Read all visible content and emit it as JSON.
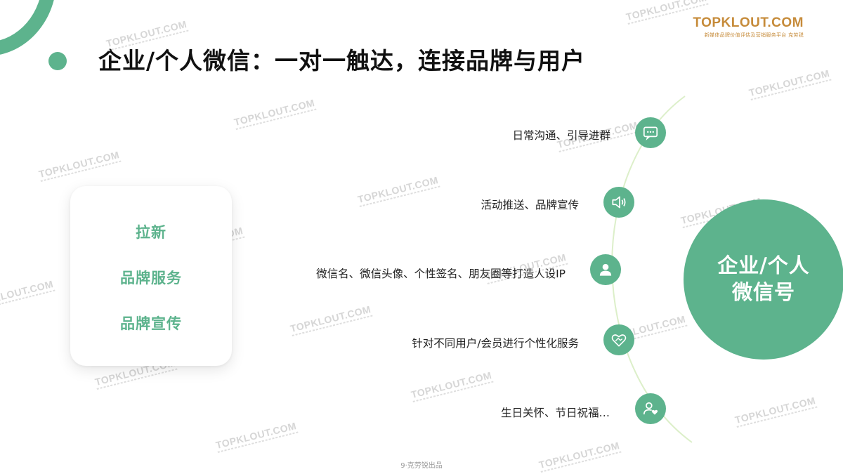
{
  "title": "企业/个人微信：一对一触达，连接品牌与用户",
  "logo": {
    "main": "TOPKLOUT.COM",
    "sub": "克劳锐",
    "sub_caption": "新媒体品牌价值评估及营销服务平台",
    "brand_color": "#c68b3a"
  },
  "watermark_text": "TOPKLOUT.COM",
  "card": {
    "items": [
      "拉新",
      "品牌服务",
      "品牌宣传"
    ]
  },
  "center": {
    "line1": "企业/个人",
    "line2": "微信号"
  },
  "nodes": [
    {
      "label": "日常沟通、引导进群",
      "icon": "chat-bubble-icon"
    },
    {
      "label": "活动推送、品牌宣传",
      "icon": "speaker-icon"
    },
    {
      "label": "微信名、微信头像、个性签名、朋友圈等打造人设IP",
      "icon": "user-icon"
    },
    {
      "label": "针对不同用户/会员进行个性化服务",
      "icon": "handshake-heart-icon"
    },
    {
      "label": "生日关怀、节日祝福…",
      "icon": "user-heart-icon"
    }
  ],
  "footer": "9·克劳锐出品",
  "colors": {
    "accent": "#5db38d",
    "arc": "#dcefc9",
    "watermark": "#d6d6d6"
  }
}
